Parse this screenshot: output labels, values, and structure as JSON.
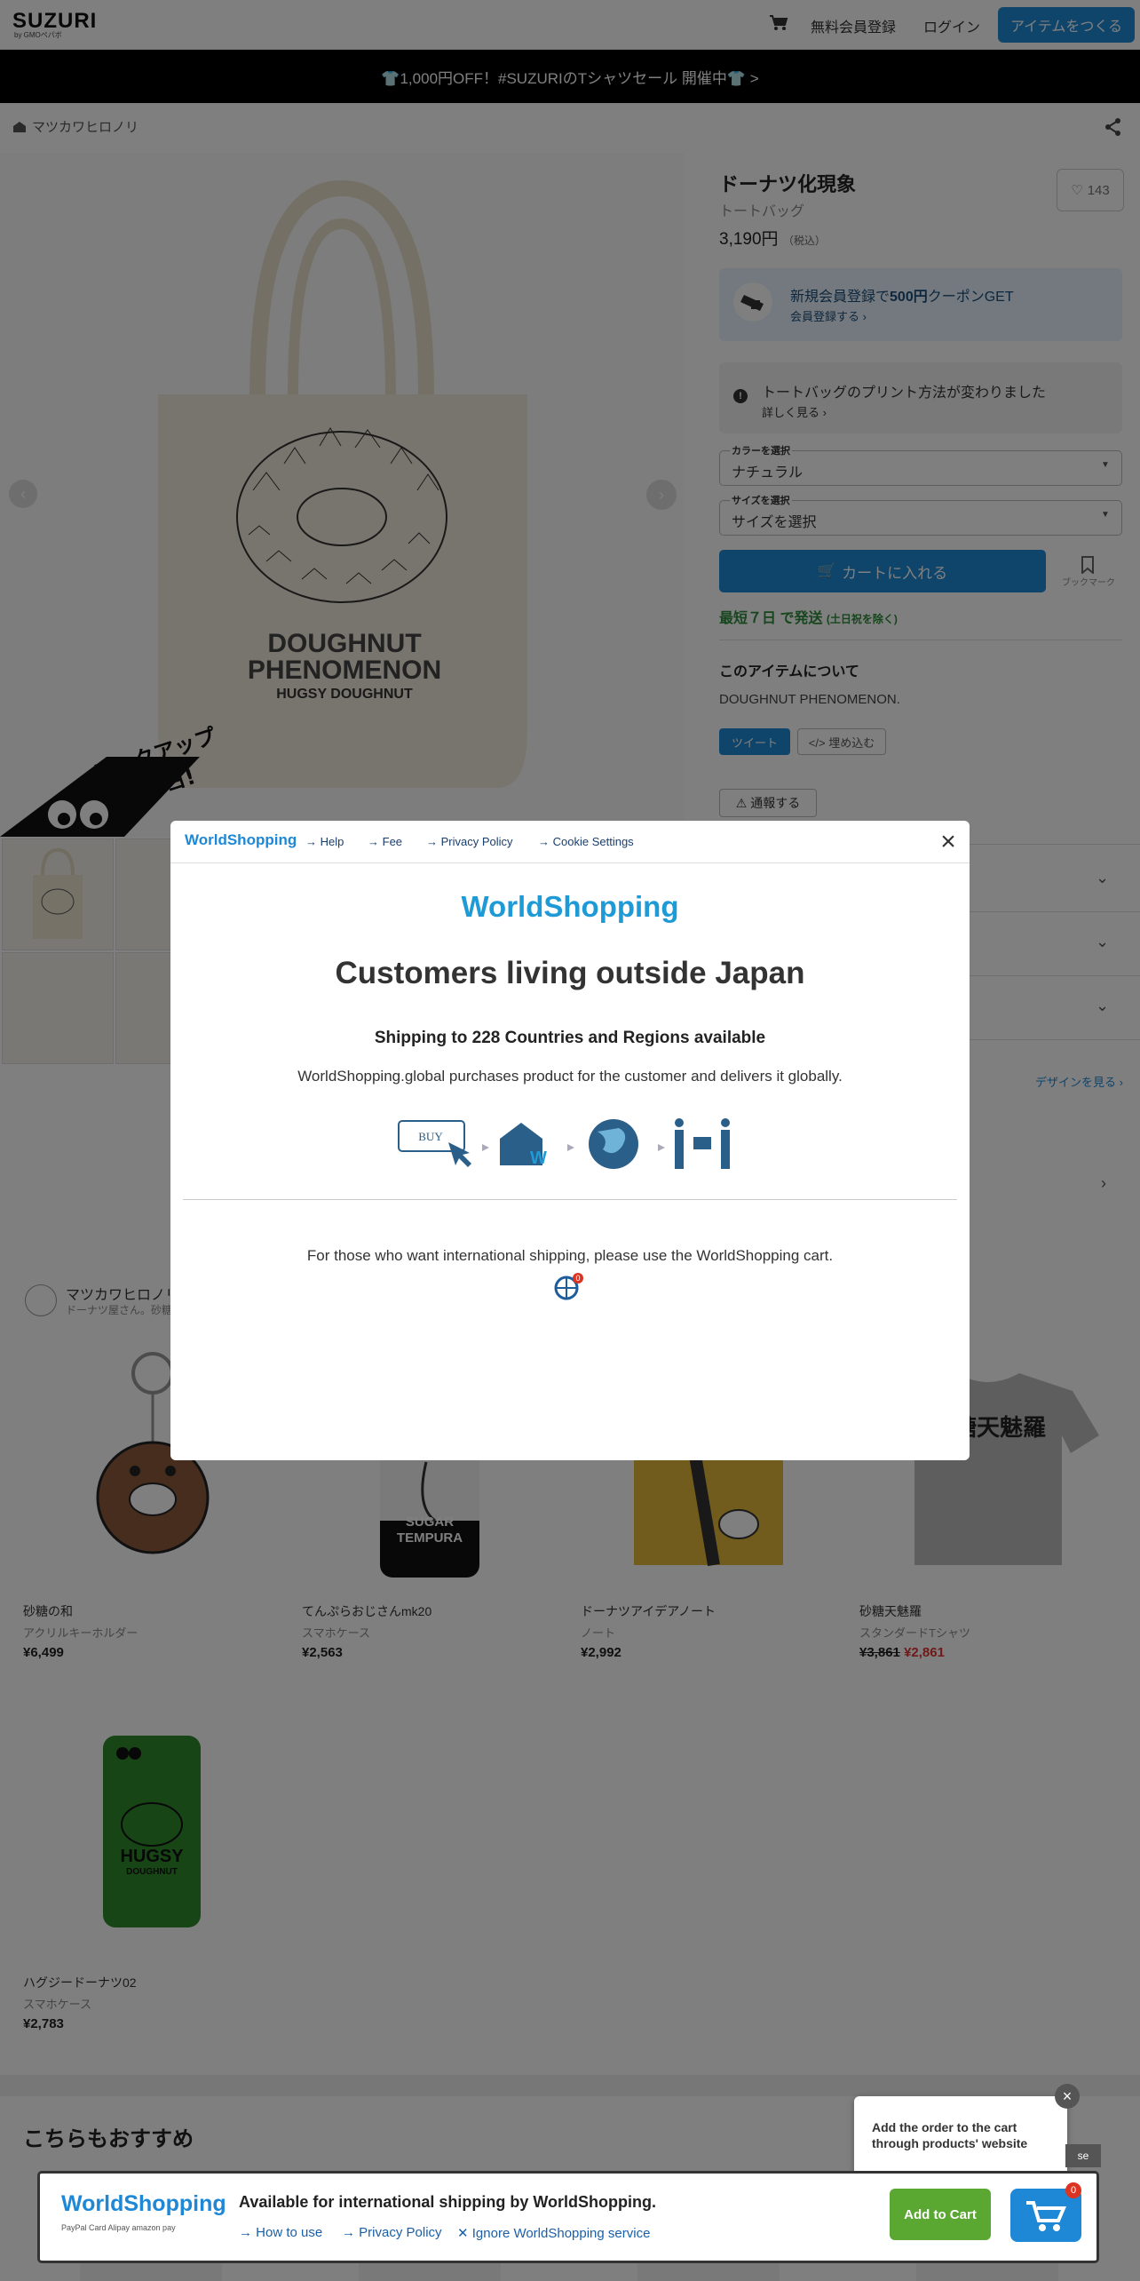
{
  "header": {
    "logo": "SUZURI",
    "logo_sub": "by GMOペパボ",
    "signup": "無料会員登録",
    "login": "ログイン",
    "make_item": "アイテムをつくる"
  },
  "banner": "👕1,000円OFF！#SUZURIのTシャツセール 開催中👕 >",
  "breadcrumb": "マツカワヒロノリ",
  "gallery": {
    "print_line1": "DOUGHNUT",
    "print_line2": "PHENOMENON",
    "print_line3": "HUGSY DOUGHNUT",
    "pickup_line1": "ピックアップ",
    "pickup_line2": "サレタヨ!"
  },
  "product": {
    "title": "ドーナツ化現象",
    "type": "トートバッグ",
    "price": "3,190円",
    "price_tax": "（税込）",
    "likes": "143",
    "coupon_title_pre": "新規会員登録で",
    "coupon_title_bold": "500円",
    "coupon_title_post": "クーポンGET",
    "coupon_link": "会員登録する ›",
    "notice_title": "トートバッグのプリント方法が変わりました",
    "notice_link": "詳しく見る ›",
    "color_label": "カラーを選択",
    "color_value": "ナチュラル",
    "size_label": "サイズを選択",
    "size_value": "サイズを選択",
    "cart_button": "カートに入れる",
    "bookmark": "ブックマーク",
    "shipping": "最短７日 で発送",
    "shipping_note": "(土日祝を除く)",
    "about_title": "このアイテムについて",
    "description": "DOUGHNUT PHENOMENON.",
    "tweet": "ツイート",
    "embed": "</> 埋め込む",
    "report": "通報する",
    "design_link": "デザインを見る ›"
  },
  "shop": {
    "name": "マツカワヒロノリ",
    "sub": "ドーナツ屋さん。砂糖"
  },
  "cards": [
    {
      "name": "砂糖の和",
      "type": "アクリルキーホルダー",
      "price": "¥6,499"
    },
    {
      "name": "てんぷらおじさんmk20",
      "type": "スマホケース",
      "price": "¥2,563",
      "art_line1": "SUGAR",
      "art_line2": "TEMPURA"
    },
    {
      "name": "ドーナツアイデアノート",
      "type": "ノート",
      "price": "¥2,992"
    },
    {
      "name": "砂糖天魅羅",
      "type": "スタンダードTシャツ",
      "old_price": "¥3,861",
      "price": "¥2,861",
      "art": "砂糖天魅羅"
    },
    {
      "name": "ハグジードーナツ02",
      "type": "スマホケース",
      "price": "¥2,783",
      "art_line1": "HUGSY",
      "art_line2": "DOUGHNUT"
    }
  ],
  "recommend_title": "こちらもおすすめ",
  "modal": {
    "logo": "WorldShopping",
    "links": [
      "Help",
      "Fee",
      "Privacy Policy",
      "Cookie Settings"
    ],
    "title": "Customers living outside Japan",
    "subtitle": "Shipping to 228 Countries and Regions available",
    "description": "WorldShopping.global purchases product for the customer and delivers it globally.",
    "step_buy": "BUY",
    "note": "For those who want international shipping, please use the WorldShopping cart.",
    "badge": "0"
  },
  "ws_bar": {
    "logo": "WorldShopping",
    "payments": "PayPal  Card  Alipay  amazon pay",
    "title": "Available for international shipping by WorldShopping.",
    "how_to_use": "How to use",
    "privacy": "Privacy Policy",
    "ignore": "Ignore WorldShopping service",
    "add_to_cart": "Add to Cart",
    "cart_count": "0",
    "tip": "Add the order to the cart through products' website",
    "tip_close": "×",
    "tip_se": "se"
  },
  "colors": {
    "accent": "#1e88d6",
    "ship_green": "#2e8b3b",
    "sale_red": "#e23232",
    "ws_green": "#5aa832"
  }
}
